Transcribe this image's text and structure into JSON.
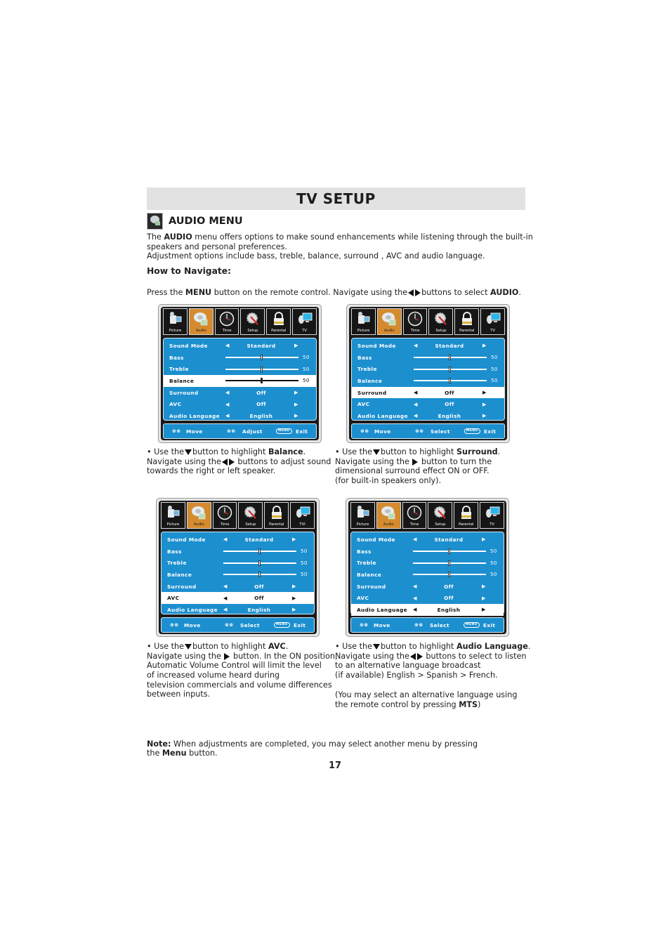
{
  "page": {
    "title": "TV SETUP",
    "section_title": "AUDIO MENU",
    "section_icon": "audio-icon",
    "page_number": "17"
  },
  "intro": {
    "line1_pre": "The ",
    "line1_bold": "AUDIO",
    "line1_post": " menu offers options to make sound enhancements while listening through the built-in",
    "line2": "speakers and personal preferences.",
    "line3": "Adjustment options include bass, treble, balance, surround , AVC and audio language."
  },
  "how_to": {
    "heading": "How to Navigate:",
    "press_pre": "Press the ",
    "press_bold": "MENU",
    "press_mid": " button on the remote control. Navigate using the",
    "press_post": "buttons to select ",
    "press_bold2": "AUDIO",
    "press_end": "."
  },
  "osd_tabs": [
    {
      "label": "Picture",
      "icon": "camcorder-icon"
    },
    {
      "label": "Audio",
      "icon": "audio-icon"
    },
    {
      "label": "Time",
      "icon": "clock-icon"
    },
    {
      "label": "Setup",
      "icon": "gear-wrench-icon"
    },
    {
      "label": "Parental",
      "icon": "lock-icon"
    },
    {
      "label": "TV",
      "icon": "tv-antenna-icon"
    }
  ],
  "screens": [
    {
      "tab_last_label": "TV",
      "highlighted": "Balance",
      "rows": [
        {
          "label": "Sound Mode",
          "value": "Standard"
        },
        {
          "label": "Bass",
          "value": "50",
          "level": 0.5
        },
        {
          "label": "Treble",
          "value": "50",
          "level": 0.5
        },
        {
          "label": "Balance",
          "value": "50",
          "level": 0.5
        },
        {
          "label": "Surround",
          "value": "Off"
        },
        {
          "label": "AVC",
          "value": "Off"
        },
        {
          "label": "Audio Language",
          "value": "English"
        }
      ],
      "footer": {
        "move": "Move",
        "action": "Adjust",
        "menu_key": "MENU",
        "exit": "Exit"
      }
    },
    {
      "tab_last_label": "TV",
      "highlighted": "Surround",
      "rows": [
        {
          "label": "Sound Mode",
          "value": "Standard"
        },
        {
          "label": "Bass",
          "value": "50",
          "level": 0.5
        },
        {
          "label": "Treble",
          "value": "50",
          "level": 0.5
        },
        {
          "label": "Balance",
          "value": "50",
          "level": 0.5
        },
        {
          "label": "Surround",
          "value": "Off"
        },
        {
          "label": "AVC",
          "value": "Off"
        },
        {
          "label": "Audio Language",
          "value": "English"
        }
      ],
      "footer": {
        "move": "Move",
        "action": "Select",
        "menu_key": "MENU",
        "exit": "Exit"
      }
    },
    {
      "tab_last_label": "TVI",
      "highlighted": "AVC",
      "rows": [
        {
          "label": "Sound Mode",
          "value": "Standard"
        },
        {
          "label": "Bass",
          "value": "50",
          "level": 0.5
        },
        {
          "label": "Treble",
          "value": "50",
          "level": 0.5
        },
        {
          "label": "Balance",
          "value": "50",
          "level": 0.5
        },
        {
          "label": "Surround",
          "value": "Off"
        },
        {
          "label": "AVC",
          "value": "Off"
        },
        {
          "label": "Audio Language",
          "value": "English"
        }
      ],
      "footer": {
        "move": "Move",
        "action": "Select",
        "menu_key": "MENU",
        "exit": "Exit"
      }
    },
    {
      "tab_last_label": "TV",
      "highlighted": "Audio Language",
      "rows": [
        {
          "label": "Sound Mode",
          "value": "Standard"
        },
        {
          "label": "Bass",
          "value": "50",
          "level": 0.5
        },
        {
          "label": "Treble",
          "value": "50",
          "level": 0.5
        },
        {
          "label": "Balance",
          "value": "50",
          "level": 0.5
        },
        {
          "label": "Surround",
          "value": "Off"
        },
        {
          "label": "AVC",
          "value": "Off"
        },
        {
          "label": "Audio Language",
          "value": "English"
        }
      ],
      "footer": {
        "move": "Move",
        "action": "Select",
        "menu_key": "MENU",
        "exit": "Exit"
      }
    }
  ],
  "captions": {
    "balance": {
      "l1_pre": "• Use the",
      "l1_mid": "button to highlight ",
      "l1_bold": "Balance",
      "l1_end": ".",
      "l2_pre": "Navigate using the",
      "l2_post": " buttons to adjust sound",
      "l3": "towards the right or left speaker."
    },
    "surround": {
      "l1_pre": "• Use the",
      "l1_mid": "button to highlight ",
      "l1_bold": "Surround",
      "l1_end": ".",
      "l2_pre": "Navigate using the ",
      "l2_post": " button to turn the",
      "l3": "dimensional surround effect ON or OFF.",
      "l4": "(for built-in speakers only)."
    },
    "avc": {
      "l1_pre": "• Use the",
      "l1_mid": "button to highlight ",
      "l1_bold": "AVC",
      "l1_end": ".",
      "l2_pre": "Navigate using the ",
      "l2_post": " button. In the ON position,",
      "l3": "Automatic Volume Control will limit the level",
      "l4": "of increased volume heard during",
      "l5": "television commercials and volume differences",
      "l6": "between inputs."
    },
    "language": {
      "l1_pre": "• Use the",
      "l1_mid": "button to highlight ",
      "l1_bold": "Audio Language",
      "l1_end": ".",
      "l2_pre": "Navigate using the",
      "l2_post": " buttons to select to listen",
      "l3": "to an alternative language broadcast",
      "l4": "(if available) English > Spanish > French.",
      "l5": "(You may select an alternative language using",
      "l6_pre": "the remote control by pressing ",
      "l6_bold": "MTS",
      "l6_end": ")"
    }
  },
  "note": {
    "label": "Note:",
    "l1": " When adjustments are completed, you may select another menu by pressing",
    "l2_pre": "the ",
    "l2_bold": "Menu",
    "l2_end": " button."
  },
  "colors": {
    "osd_blue": "#1c8fcf",
    "active_tab": "#d48a2e",
    "title_bar": "#e2e2e3"
  }
}
